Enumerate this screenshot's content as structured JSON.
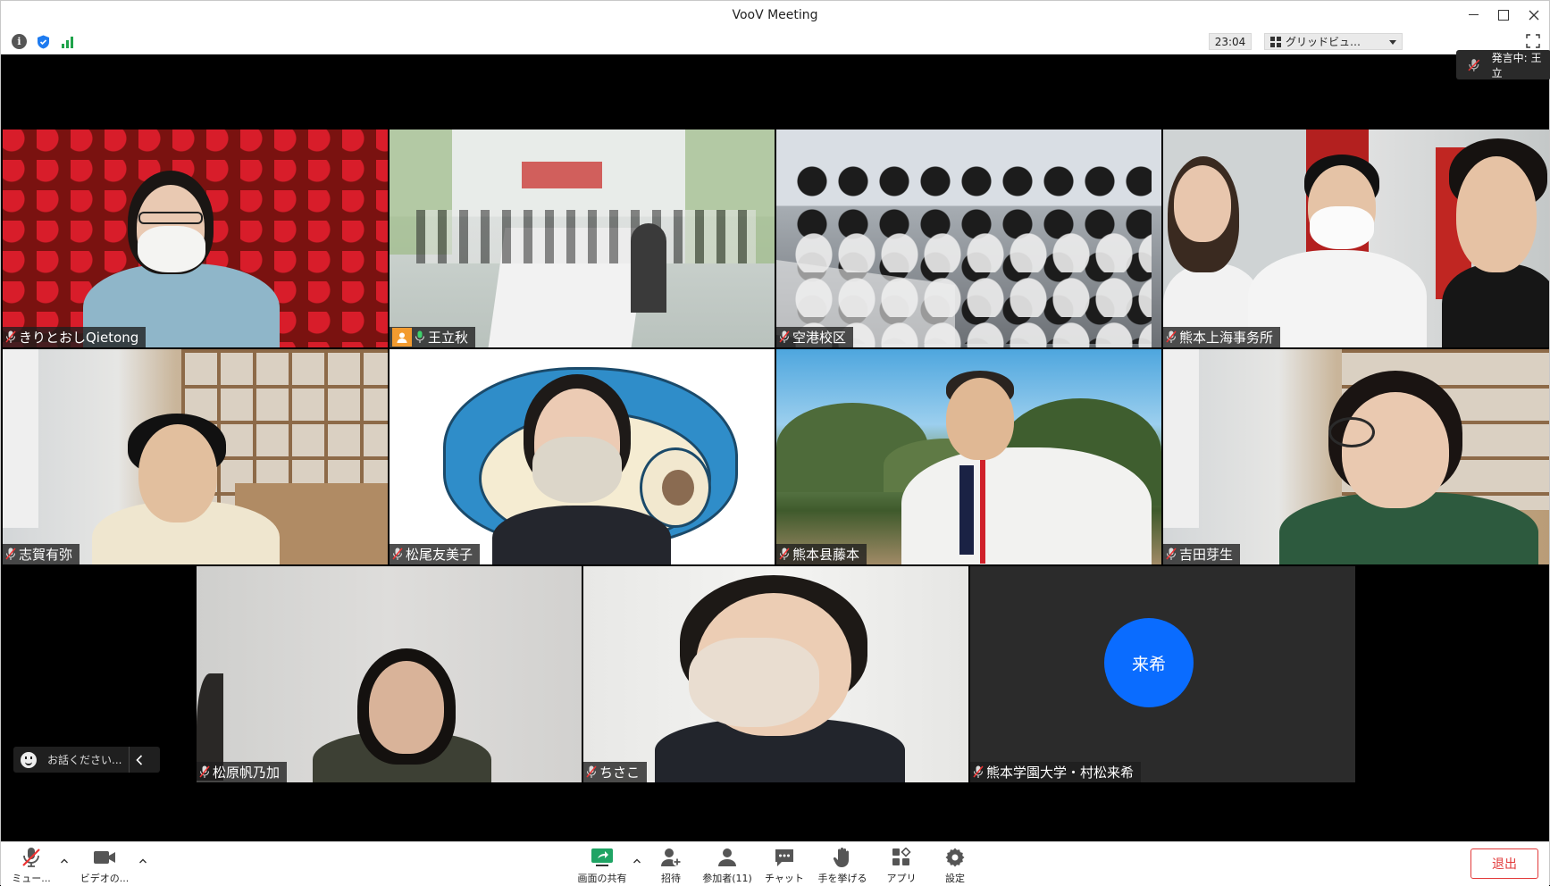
{
  "window": {
    "title": "VooV Meeting"
  },
  "infobar": {
    "clock": "23:04",
    "view_label": "グリッドビュ…"
  },
  "speaker": {
    "label": "発言中: 王立"
  },
  "tiles": [
    {
      "name": "きりとおしQietong"
    },
    {
      "name": "王立秋"
    },
    {
      "name": "空港校区"
    },
    {
      "name": "熊本上海事务所"
    },
    {
      "name": "志賀有弥"
    },
    {
      "name": "松尾友美子"
    },
    {
      "name": "熊本县藤本"
    },
    {
      "name": "吉田芽生"
    },
    {
      "name": "松原帆乃加"
    },
    {
      "name": "ちさこ"
    },
    {
      "name": "熊本学園大学・村松来希",
      "avatar_text": "来希"
    }
  ],
  "chat": {
    "placeholder": "お話ください..."
  },
  "toolbar": {
    "mute": "ミュー...",
    "video": "ビデオの...",
    "share": "画面の共有",
    "invite": "招待",
    "participants": "参加者(11)",
    "chat": "チャット",
    "raise_hand": "手を挙げる",
    "apps": "アプリ",
    "settings": "設定",
    "exit": "退出"
  },
  "colors": {
    "active_border": "#22c15e",
    "exit_red": "#e23a3a",
    "avatar_blue": "#0a6cff",
    "share_green": "#1fa464"
  }
}
